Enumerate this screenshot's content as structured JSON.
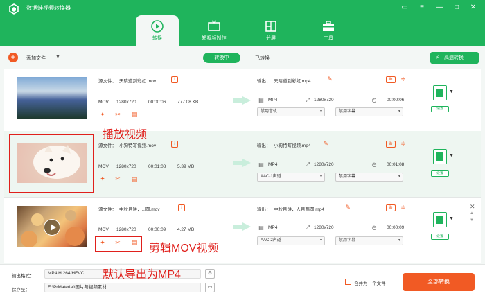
{
  "app": {
    "title": "数据蛙视频转换器"
  },
  "tabs": [
    {
      "label": "转换",
      "icon": "convert-icon"
    },
    {
      "label": "短视频制作",
      "icon": "tv-icon"
    },
    {
      "label": "分屏",
      "icon": "split-screen-icon"
    },
    {
      "label": "工具",
      "icon": "toolbox-icon"
    }
  ],
  "toolbar": {
    "add_label": "添加文件",
    "converting_tab": "转换中",
    "converted_tab": "已转换",
    "fast_convert": "高速转换"
  },
  "files": [
    {
      "source_label": "源文件：",
      "source_name": "天睛道到彩虹.mov",
      "format": "MOV",
      "resolution": "1280x720",
      "duration": "00:00:06",
      "size": "777.08 KB",
      "output_label": "输出：",
      "output_name": "天睛道到彩虹.mp4",
      "out_format": "MP4",
      "out_resolution": "1280x720",
      "out_duration": "00:00:06",
      "audio": "禁用音轨",
      "subtitle": "禁用字幕",
      "settings": "设置"
    },
    {
      "source_label": "源文件：",
      "source_name": "小狗特写视频.mov",
      "format": "MOV",
      "resolution": "1280x720",
      "duration": "00:01:08",
      "size": "5.39 MB",
      "output_label": "输出：",
      "output_name": "小狗特写视频.mp4",
      "out_format": "MP4",
      "out_resolution": "1280x720",
      "out_duration": "00:01:08",
      "audio": "AAC-1声道",
      "subtitle": "禁用字幕",
      "settings": "设置"
    },
    {
      "source_label": "源文件：",
      "source_name": "中秋月饼，...圆.mov",
      "format": "MOV",
      "resolution": "1280x720",
      "duration": "00:00:09",
      "size": "4.27 MB",
      "output_label": "输出：",
      "output_name": "中秋月饼，人月两圆.mp4",
      "out_format": "MP4",
      "out_resolution": "1280x720",
      "out_duration": "00:00:09",
      "audio": "AAC-2声道",
      "subtitle": "禁用字幕",
      "settings": "设置"
    }
  ],
  "annotations": {
    "play": "播放视频",
    "edit": "剪辑MOV视频",
    "export": "默认导出为MP4"
  },
  "footer": {
    "format_label": "输出格式：",
    "format_value": "MP4 H.264/HEVC",
    "save_label": "保存至：",
    "save_path": "E:\\PrMaterial\\图片与视频素材",
    "merge_label": "合并为一个文件",
    "convert_all": "全部转换"
  },
  "colors": {
    "brand_green": "#1fb45c",
    "accent_orange": "#f15a24",
    "annotation_red": "#e0201c"
  }
}
